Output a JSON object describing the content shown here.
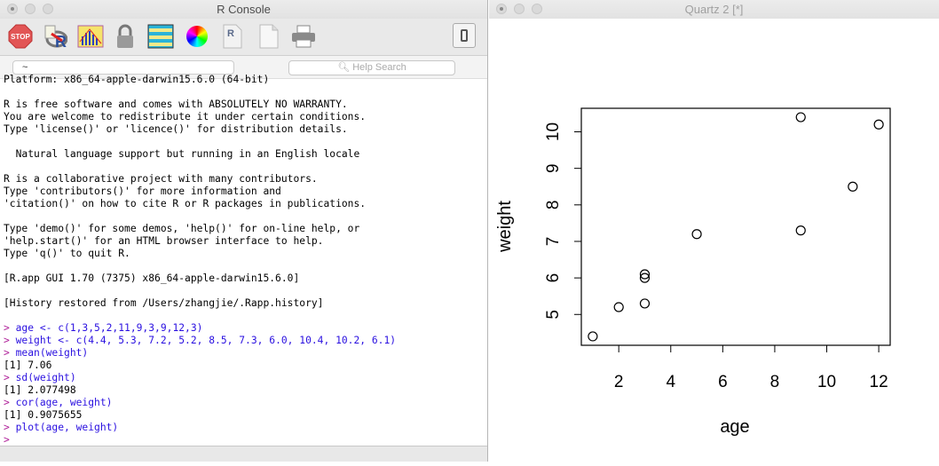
{
  "console": {
    "title": "R Console",
    "toolbar": [
      "stop-icon",
      "source-script-icon",
      "quartz-plot-icon",
      "lock-icon",
      "workspace-browser-icon",
      "color-wheel-icon",
      "r-document-icon",
      "new-document-icon",
      "print-icon"
    ],
    "path": "~",
    "search_placeholder": "Help Search",
    "lines": [
      {
        "t": "out",
        "s": "Platform: x86_64-apple-darwin15.6.0 (64-bit)"
      },
      {
        "t": "out",
        "s": ""
      },
      {
        "t": "out",
        "s": "R is free software and comes with ABSOLUTELY NO WARRANTY."
      },
      {
        "t": "out",
        "s": "You are welcome to redistribute it under certain conditions."
      },
      {
        "t": "out",
        "s": "Type 'license()' or 'licence()' for distribution details."
      },
      {
        "t": "out",
        "s": ""
      },
      {
        "t": "out",
        "s": "  Natural language support but running in an English locale"
      },
      {
        "t": "out",
        "s": ""
      },
      {
        "t": "out",
        "s": "R is a collaborative project with many contributors."
      },
      {
        "t": "out",
        "s": "Type 'contributors()' for more information and"
      },
      {
        "t": "out",
        "s": "'citation()' on how to cite R or R packages in publications."
      },
      {
        "t": "out",
        "s": ""
      },
      {
        "t": "out",
        "s": "Type 'demo()' for some demos, 'help()' for on-line help, or"
      },
      {
        "t": "out",
        "s": "'help.start()' for an HTML browser interface to help."
      },
      {
        "t": "out",
        "s": "Type 'q()' to quit R."
      },
      {
        "t": "out",
        "s": ""
      },
      {
        "t": "out",
        "s": "[R.app GUI 1.70 (7375) x86_64-apple-darwin15.6.0]"
      },
      {
        "t": "out",
        "s": ""
      },
      {
        "t": "out",
        "s": "[History restored from /Users/zhangjie/.Rapp.history]"
      },
      {
        "t": "out",
        "s": ""
      },
      {
        "t": "cmd",
        "s": "age <- c(1,3,5,2,11,9,3,9,12,3)"
      },
      {
        "t": "cmd",
        "s": "weight <- c(4.4, 5.3, 7.2, 5.2, 8.5, 7.3, 6.0, 10.4, 10.2, 6.1)"
      },
      {
        "t": "cmd",
        "s": "mean(weight)"
      },
      {
        "t": "out",
        "s": "[1] 7.06"
      },
      {
        "t": "cmd",
        "s": "sd(weight)"
      },
      {
        "t": "out",
        "s": "[1] 2.077498"
      },
      {
        "t": "cmd",
        "s": "cor(age, weight)"
      },
      {
        "t": "out",
        "s": "[1] 0.9075655"
      },
      {
        "t": "cmd",
        "s": "plot(age, weight)"
      },
      {
        "t": "cmd",
        "s": ""
      }
    ],
    "prompt": ">"
  },
  "quartz": {
    "title": "Quartz 2 [*]"
  },
  "chart_data": {
    "type": "scatter",
    "x": [
      1,
      3,
      5,
      2,
      11,
      9,
      3,
      9,
      12,
      3
    ],
    "y": [
      4.4,
      5.3,
      7.2,
      5.2,
      8.5,
      7.3,
      6.0,
      10.4,
      10.2,
      6.1
    ],
    "xlabel": "age",
    "ylabel": "weight",
    "xticks": [
      2,
      4,
      6,
      8,
      10,
      12
    ],
    "yticks": [
      5,
      6,
      7,
      8,
      9,
      10
    ],
    "xlim": [
      0.56,
      12.44
    ],
    "ylim": [
      4.156,
      10.644
    ],
    "grid": false
  }
}
